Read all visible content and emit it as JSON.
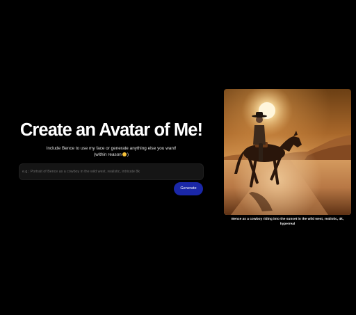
{
  "hero": {
    "title": "Create an Avatar of Me!",
    "subtitle_line1": "Include Bence to use my face or generate anything else you want!",
    "subtitle_line2_prefix": "(within reason",
    "subtitle_line2_suffix": ")"
  },
  "prompt": {
    "placeholder": "e.g.: Portrait of Bence as a cowboy in the wild west, realistic, intricate 8k",
    "value": ""
  },
  "generate_button": {
    "label": "Generate"
  },
  "result": {
    "image_icon": "cowboy-on-horse-sunset-image",
    "caption": "Bence as a cowboy riding into the sunset in the wild west, realistic, 4k, hyperreal"
  },
  "colors": {
    "background": "#000000",
    "accent_button": "#1a27a8",
    "input_background": "#151515"
  }
}
